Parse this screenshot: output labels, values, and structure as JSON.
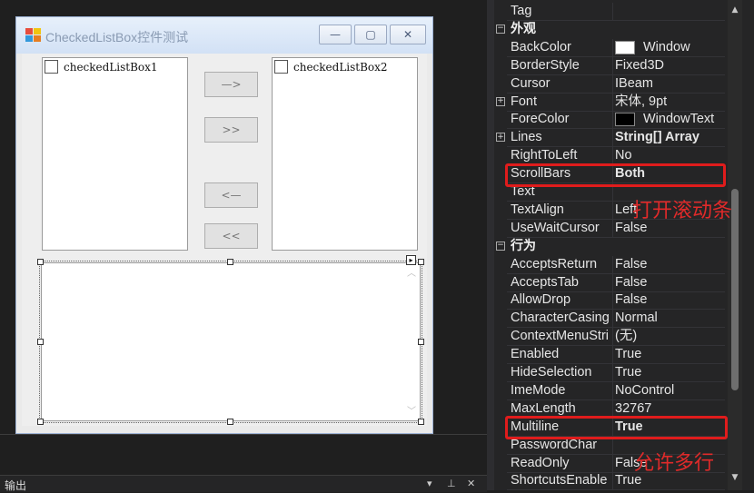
{
  "designer": {
    "form_title": "CheckedListBox控件测试",
    "caption_buttons": {
      "minimize": "—",
      "maximize": "▢",
      "close": "✕"
    },
    "checked_list_box_1": "checkedListBox1",
    "checked_list_box_2": "checkedListBox2",
    "buttons": {
      "move_right": "—>",
      "move_all_right": ">>",
      "move_left": "<—",
      "move_all_left": "<<"
    },
    "smart_tag": "▸",
    "textbox_scroll_up": "︿",
    "textbox_scroll_down": "﹀"
  },
  "output_panel": {
    "title": "输出",
    "pin": "⊥",
    "close": "✕"
  },
  "property_grid": {
    "rows": [
      {
        "kind": "prop",
        "name": "Tag",
        "value": ""
      },
      {
        "kind": "category",
        "name": "外观"
      },
      {
        "kind": "prop",
        "name": "BackColor",
        "value": "Window",
        "swatch": "#ffffff"
      },
      {
        "kind": "prop",
        "name": "BorderStyle",
        "value": "Fixed3D"
      },
      {
        "kind": "prop",
        "name": "Cursor",
        "value": "IBeam"
      },
      {
        "kind": "prop",
        "name": "Font",
        "value": "宋体, 9pt",
        "expandable": true
      },
      {
        "kind": "prop",
        "name": "ForeColor",
        "value": "WindowText",
        "swatch": "#000000"
      },
      {
        "kind": "prop",
        "name": "Lines",
        "value": "String[] Array",
        "bold": true,
        "expandable": true
      },
      {
        "kind": "prop",
        "name": "RightToLeft",
        "value": "No"
      },
      {
        "kind": "prop",
        "name": "ScrollBars",
        "value": "Both",
        "bold": true
      },
      {
        "kind": "prop",
        "name": "Text",
        "value": ""
      },
      {
        "kind": "prop",
        "name": "TextAlign",
        "value": "Left"
      },
      {
        "kind": "prop",
        "name": "UseWaitCursor",
        "value": "False"
      },
      {
        "kind": "category",
        "name": "行为"
      },
      {
        "kind": "prop",
        "name": "AcceptsReturn",
        "value": "False"
      },
      {
        "kind": "prop",
        "name": "AcceptsTab",
        "value": "False"
      },
      {
        "kind": "prop",
        "name": "AllowDrop",
        "value": "False"
      },
      {
        "kind": "prop",
        "name": "CharacterCasing",
        "value": "Normal"
      },
      {
        "kind": "prop",
        "name": "ContextMenuStri",
        "value": "(无)"
      },
      {
        "kind": "prop",
        "name": "Enabled",
        "value": "True"
      },
      {
        "kind": "prop",
        "name": "HideSelection",
        "value": "True"
      },
      {
        "kind": "prop",
        "name": "ImeMode",
        "value": "NoControl"
      },
      {
        "kind": "prop",
        "name": "MaxLength",
        "value": "32767"
      },
      {
        "kind": "prop",
        "name": "Multiline",
        "value": "True",
        "bold": true
      },
      {
        "kind": "prop",
        "name": "PasswordChar",
        "value": ""
      },
      {
        "kind": "prop",
        "name": "ReadOnly",
        "value": "False"
      },
      {
        "kind": "prop",
        "name": "ShortcutsEnable",
        "value": "True"
      }
    ],
    "scroll_up": "▲",
    "scroll_down": "▼"
  },
  "annotations": {
    "scrollbars_note": "打开滚动条",
    "multiline_note": "允许多行",
    "color": "#e02a2a"
  }
}
